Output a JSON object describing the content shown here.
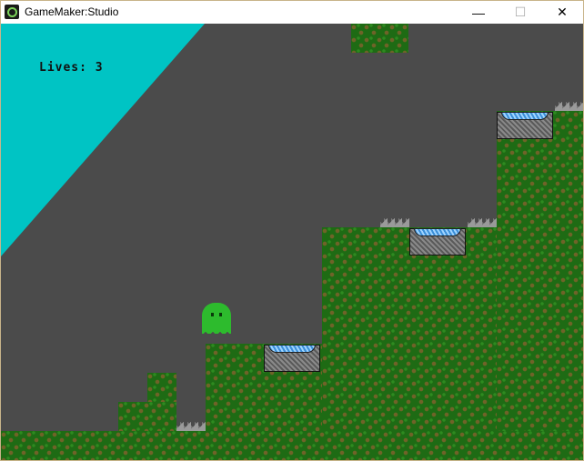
{
  "window": {
    "title": "GameMaker:Studio",
    "icons": [
      "gamemaker-logo-icon",
      "minimize-icon",
      "maximize-icon",
      "close-icon"
    ],
    "glyphs": {
      "minimize": "—",
      "maximize": "☐",
      "close": "✕"
    }
  },
  "hud": {
    "lives_text": "Lives: 3"
  },
  "colors": {
    "sky_cyan": "#00c4c4",
    "background_gray": "#4b4b4b",
    "grass_green": "#1e6b14",
    "grass_dirt": "#6f6328",
    "player_green": "#2dbb2d",
    "spring_blue": "#3b8fd8"
  }
}
